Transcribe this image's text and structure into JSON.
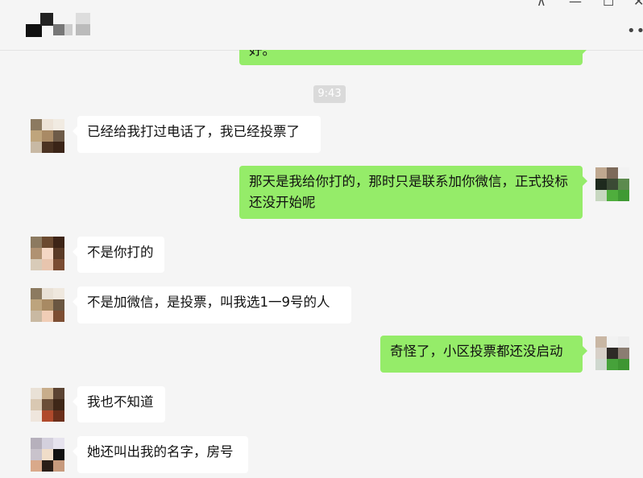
{
  "window": {
    "controls": {
      "pin": "⊼",
      "minimize": "—",
      "maximize": "☐",
      "close": "✕"
    },
    "more": "•••"
  },
  "chat": {
    "top_partial_text": "好。",
    "timestamp": "9:43",
    "messages": [
      {
        "side": "in",
        "text": "已经给我打过电话了，我已经投票了"
      },
      {
        "side": "out",
        "text": "那天是我给你打的，那时只是联系加你微信，正式投标还没开始呢"
      },
      {
        "side": "in",
        "text": "不是你打的"
      },
      {
        "side": "in",
        "text": "不是加微信，是投票，叫我选1一9号的人"
      },
      {
        "side": "out",
        "text": "奇怪了，小区投票都还没启动"
      },
      {
        "side": "in",
        "text": "我也不知道"
      },
      {
        "side": "in",
        "text": "她还叫出我的名字，房号"
      }
    ]
  },
  "colors": {
    "outgoing_bubble": "#95ec69",
    "incoming_bubble": "#ffffff",
    "background": "#f5f5f5"
  }
}
